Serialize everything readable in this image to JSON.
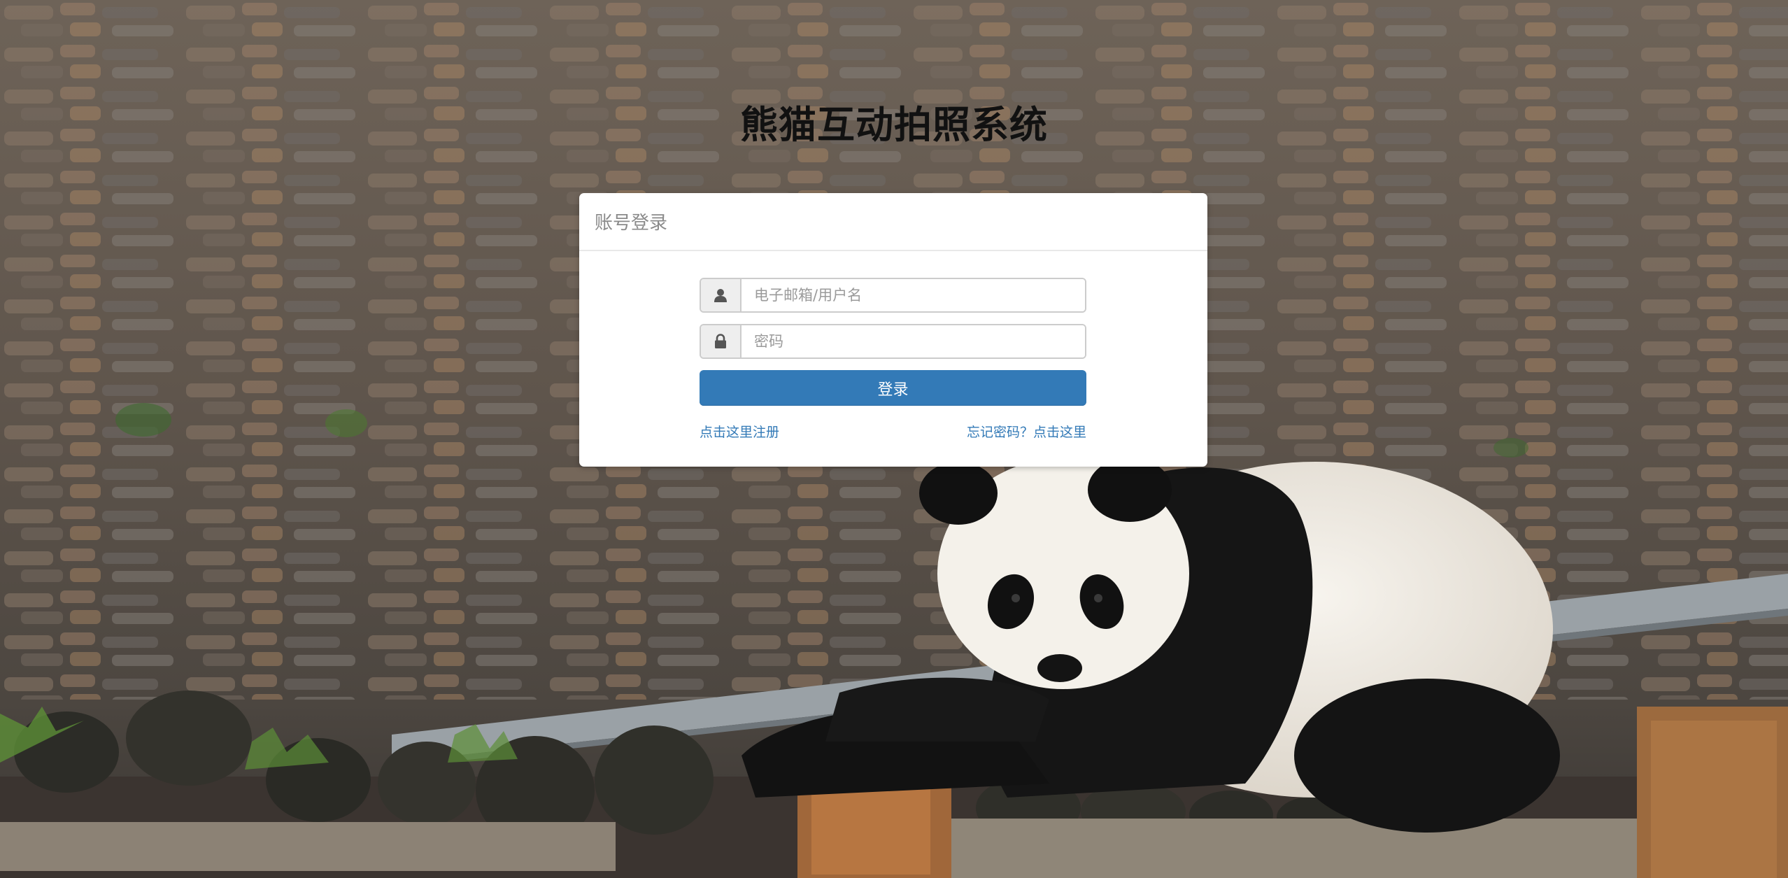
{
  "site": {
    "title": "熊猫互动拍照系统"
  },
  "login_panel": {
    "heading": "账号登录",
    "username_placeholder": "电子邮箱/用户名",
    "password_placeholder": "密码",
    "username_value": "",
    "password_value": "",
    "login_label": "登录",
    "register_link": "点击这里注册",
    "forgot_link": "忘记密码？点击这里"
  },
  "icons": {
    "user": "user-icon",
    "lock": "lock-icon"
  },
  "colors": {
    "primary": "#337ab7",
    "panel_bg": "#ffffff",
    "heading_text": "#8a8a8a",
    "title_text": "#111111"
  }
}
